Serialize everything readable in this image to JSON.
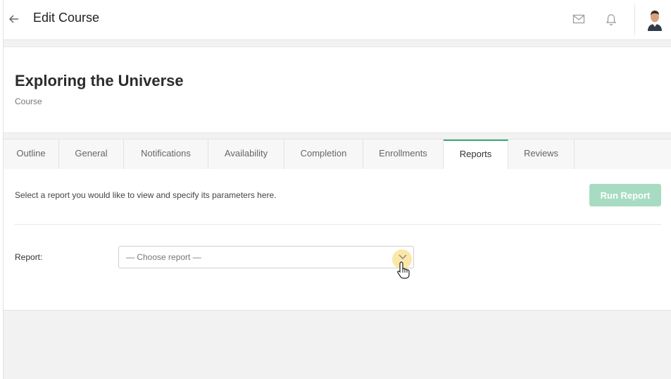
{
  "header": {
    "back_icon": "arrow-left-icon",
    "title": "Edit Course",
    "icons": [
      "mail-icon",
      "bell-icon"
    ],
    "avatar": "user-avatar"
  },
  "course": {
    "title": "Exploring the Universe",
    "type": "Course"
  },
  "tabs": [
    {
      "label": "Outline"
    },
    {
      "label": "General"
    },
    {
      "label": "Notifications"
    },
    {
      "label": "Availability"
    },
    {
      "label": "Completion"
    },
    {
      "label": "Enrollments"
    },
    {
      "label": "Reports",
      "active": true
    },
    {
      "label": "Reviews"
    }
  ],
  "reports": {
    "intro": "Select a report you would like to view and specify its parameters here.",
    "run_button": "Run Report",
    "report_label": "Report:",
    "select_value": "— Choose report —"
  },
  "colors": {
    "accent": "#3aa776",
    "button_disabled": "#a8dcc2"
  }
}
